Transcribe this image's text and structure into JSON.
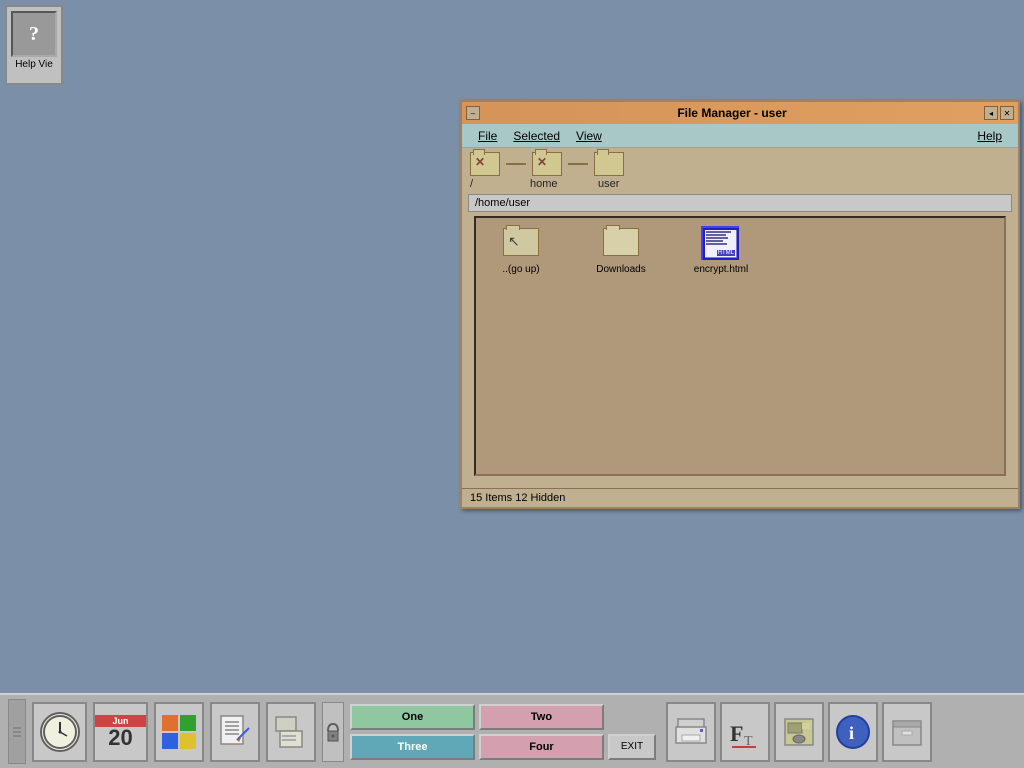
{
  "desktop": {
    "bg_color": "#7b90a8"
  },
  "help_viewer": {
    "label": "Help Vie",
    "icon": "?"
  },
  "file_manager": {
    "title": "File Manager - user",
    "menu": {
      "file": "File",
      "selected": "Selected",
      "view": "View",
      "help": "Help"
    },
    "path_parts": [
      "/",
      "home",
      "user"
    ],
    "current_path": "/home/user",
    "items": [
      {
        "name": "..(go up)",
        "type": "folder-up"
      },
      {
        "name": "Downloads",
        "type": "folder"
      },
      {
        "name": "encrypt.html",
        "type": "html",
        "selected": true
      }
    ],
    "status": "15 Items 12 Hidden"
  },
  "taskbar": {
    "calendar": {
      "month": "Jun",
      "day": "20"
    },
    "buttons": {
      "one": "One",
      "two": "Two",
      "three": "Three",
      "four": "Four",
      "exit": "EXIT"
    }
  }
}
